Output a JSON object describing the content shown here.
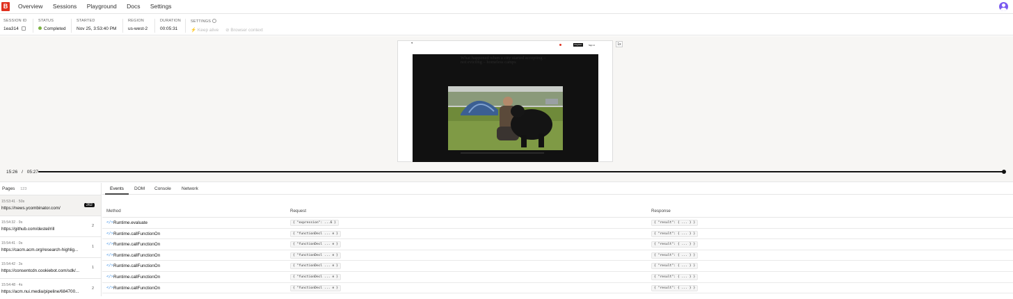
{
  "logo": "B",
  "nav": [
    "Overview",
    "Sessions",
    "Playground",
    "Docs",
    "Settings"
  ],
  "session": {
    "id_label": "SESSION ID",
    "id": "1ea314",
    "status_label": "STATUS",
    "status": "Completed",
    "started_label": "STARTED",
    "started": "Nov 25, 3:53:40 PM",
    "region_label": "REGION",
    "region": "us-west-2",
    "duration_label": "DURATION",
    "duration": "00:05:31",
    "settings_label": "SETTINGS",
    "keep_alive": "Keep alive",
    "browser_context": "Browser context"
  },
  "viewer": {
    "zoom": "1x",
    "headline": "What happened when a city started accepting – not evicting – homeless camps",
    "register": "Register",
    "sign_in": "Sign in",
    "time_current": "15:26",
    "time_sep": "/",
    "time_total": "05:27",
    "progress": 1.0
  },
  "pages": {
    "title": "Pages",
    "count": "123",
    "items": [
      {
        "meta": "15:53:41 · 50s",
        "url": "https://news.ycombinator.com/",
        "count": "262"
      },
      {
        "meta": "15:54:32 · 9s",
        "url": "https://github.com/destel/rill",
        "count": "2"
      },
      {
        "meta": "15:54:41 · 0s",
        "url": "https://cacm.acm.org/research-highlig...",
        "count": "1"
      },
      {
        "meta": "15:54:42 · 3s",
        "url": "https://consentcdn.cookiebot.com/sdk/...",
        "count": "1"
      },
      {
        "meta": "15:54:48 · 4s",
        "url": "https://acm.nui.media/pipeline/684700...",
        "count": "2"
      }
    ]
  },
  "tabs": [
    "Events",
    "DOM",
    "Console",
    "Network"
  ],
  "columns": {
    "method": "Method",
    "request": "Request",
    "response": "Response"
  },
  "events": [
    {
      "method": "Runtime.evaluate",
      "request": "{ \"expression\": ...6 }",
      "response": "{ \"result\": { ... } }"
    },
    {
      "method": "Runtime.callFunctionOn",
      "request": "{ \"functionDecl ... e }",
      "response": "{ \"result\": { ... } }"
    },
    {
      "method": "Runtime.callFunctionOn",
      "request": "{ \"functionDecl ... e }",
      "response": "{ \"result\": { ... } }"
    },
    {
      "method": "Runtime.callFunctionOn",
      "request": "{ \"functionDecl ... e }",
      "response": "{ \"result\": { ... } }"
    },
    {
      "method": "Runtime.callFunctionOn",
      "request": "{ \"functionDecl ... e }",
      "response": "{ \"result\": { ... } }"
    },
    {
      "method": "Runtime.callFunctionOn",
      "request": "{ \"functionDecl ... e }",
      "response": "{ \"result\": { ... } }"
    },
    {
      "method": "Runtime.callFunctionOn",
      "request": "{ \"functionDecl ... e }",
      "response": "{ \"result\": { ... } }"
    }
  ]
}
